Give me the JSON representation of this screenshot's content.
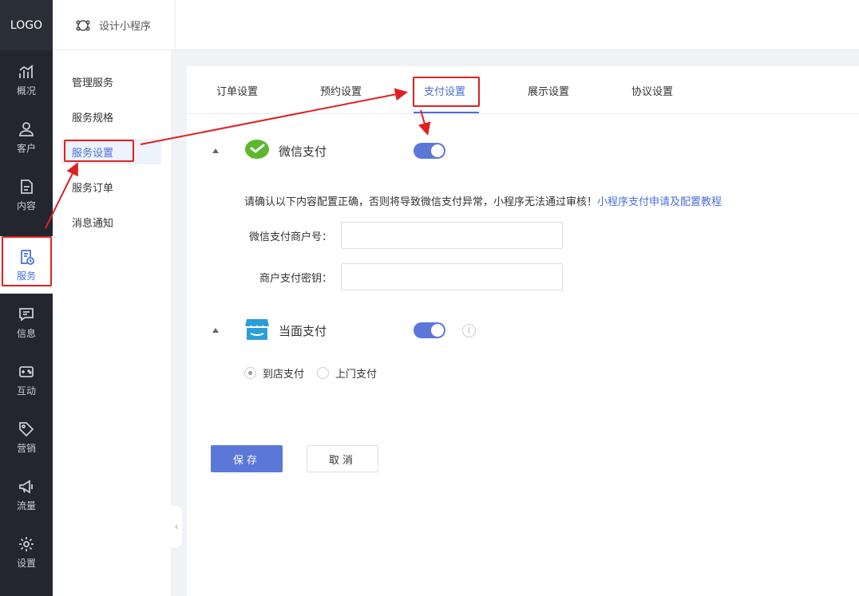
{
  "nav": {
    "logo": "LOGO",
    "items": [
      {
        "label": "概况",
        "icon": "chart-icon"
      },
      {
        "label": "客户",
        "icon": "user-icon"
      },
      {
        "label": "内容",
        "icon": "document-icon"
      },
      {
        "label": "服务",
        "icon": "service-icon"
      },
      {
        "label": "信息",
        "icon": "message-icon"
      },
      {
        "label": "互动",
        "icon": "gamepad-icon"
      },
      {
        "label": "营销",
        "icon": "tag-icon"
      },
      {
        "label": "流量",
        "icon": "megaphone-icon"
      },
      {
        "label": "设置",
        "icon": "gear-icon"
      }
    ],
    "active": "服务"
  },
  "header": {
    "tab_label": "设计小程序",
    "tab_icon": "mini-program-icon"
  },
  "subnav": {
    "items": [
      "管理服务",
      "服务规格",
      "服务设置",
      "服务订单",
      "消息通知"
    ],
    "active": "服务设置"
  },
  "tabs": {
    "items": [
      "订单设置",
      "预约设置",
      "支付设置",
      "展示设置",
      "协议设置"
    ],
    "active": "支付设置"
  },
  "wechat_pay": {
    "title": "微信支付",
    "icon": "wechat-icon",
    "enabled": true,
    "notice": "请确认以下内容配置正确，否则将导致微信支付异常，小程序无法通过审核！",
    "notice_link": "小程序支付申请及配置教程",
    "merchant_id_label": "微信支付商户号：",
    "merchant_id_value": "",
    "secret_label": "商户支付密钥：",
    "secret_value": ""
  },
  "face_pay": {
    "title": "当面支付",
    "icon": "shop-icon",
    "enabled": true,
    "info_icon": "info-icon",
    "options": [
      "到店支付",
      "上门支付"
    ],
    "selected": "到店支付"
  },
  "buttons": {
    "save": "保存",
    "cancel": "取消"
  },
  "colors": {
    "accent": "#5b78d9",
    "annotation": "#e02020",
    "sidebar": "#23262e"
  }
}
